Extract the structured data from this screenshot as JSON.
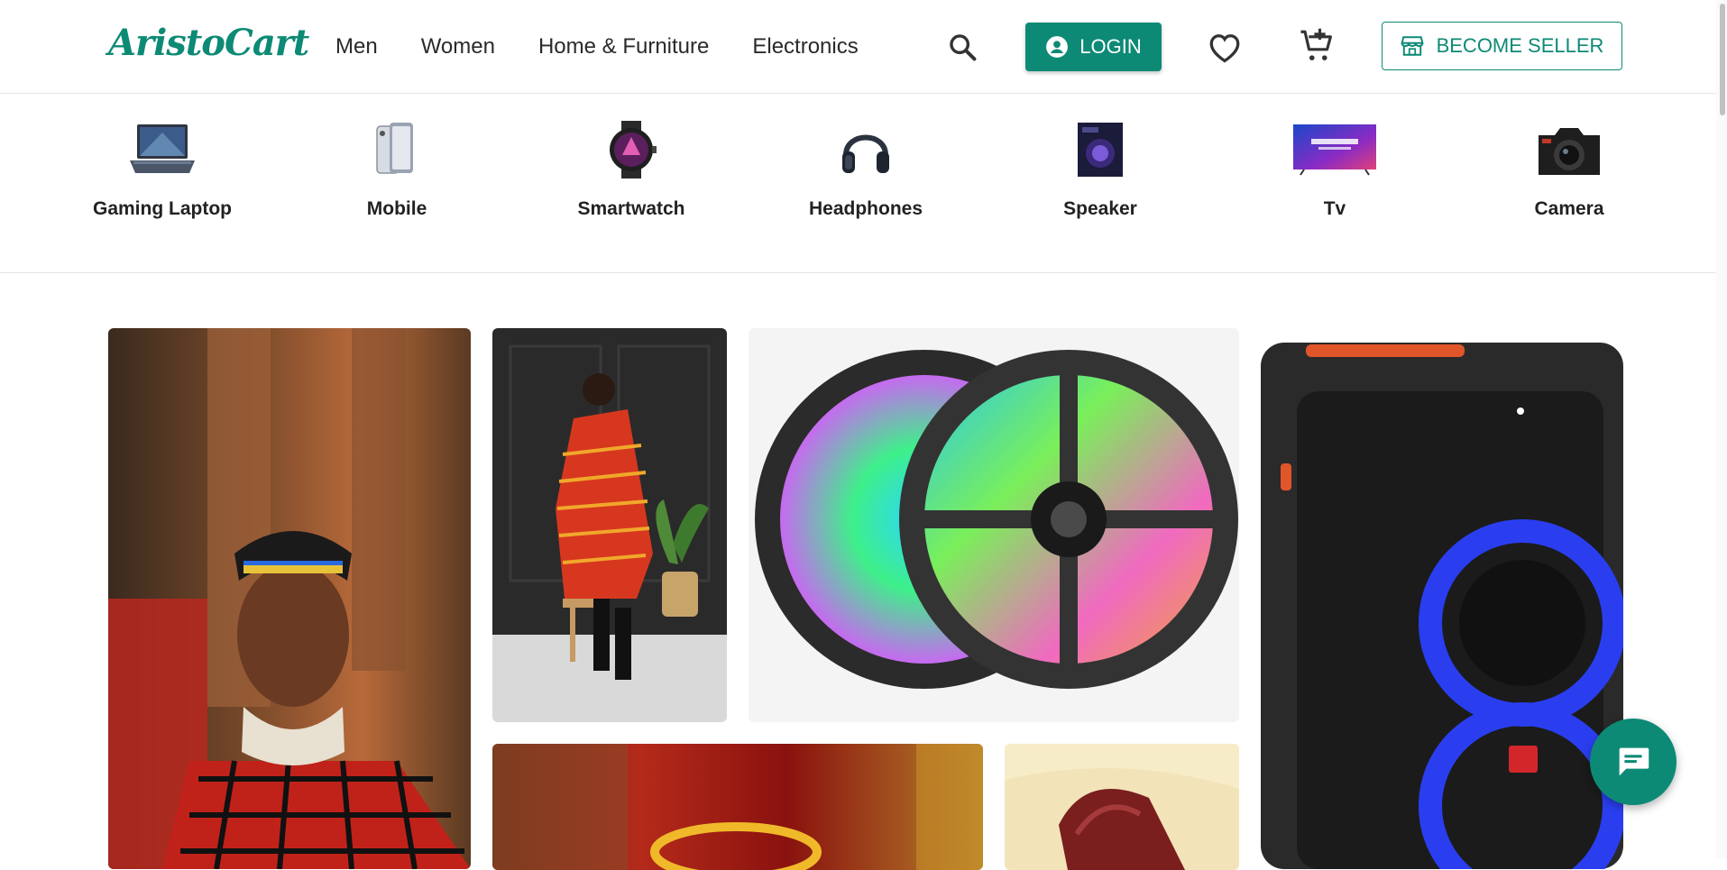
{
  "brand": {
    "name": "AristoCart",
    "accent": "#0d8a75"
  },
  "nav": {
    "items": [
      "Men",
      "Women",
      "Home & Furniture",
      "Electronics"
    ]
  },
  "header": {
    "login_label": "LOGIN",
    "seller_label": "BECOME SELLER",
    "icons": [
      "search-icon",
      "user-icon",
      "heart-icon",
      "cart-add-icon",
      "store-icon"
    ]
  },
  "categories": [
    {
      "label": "Gaming Laptop",
      "icon": "laptop"
    },
    {
      "label": "Mobile",
      "icon": "mobile"
    },
    {
      "label": "Smartwatch",
      "icon": "smartwatch"
    },
    {
      "label": "Headphones",
      "icon": "headphones"
    },
    {
      "label": "Speaker",
      "icon": "speaker"
    },
    {
      "label": "Tv",
      "icon": "tv"
    },
    {
      "label": "Camera",
      "icon": "camera"
    }
  ],
  "tiles": [
    {
      "name": "woman-traditional-outfit"
    },
    {
      "name": "man-shuka-portrait"
    },
    {
      "name": "rgb-led-strip-reels"
    },
    {
      "name": "jbl-party-speaker"
    },
    {
      "name": "gold-jewelry"
    },
    {
      "name": "maroon-slipper"
    }
  ],
  "chat": {
    "icon": "chat-icon"
  }
}
